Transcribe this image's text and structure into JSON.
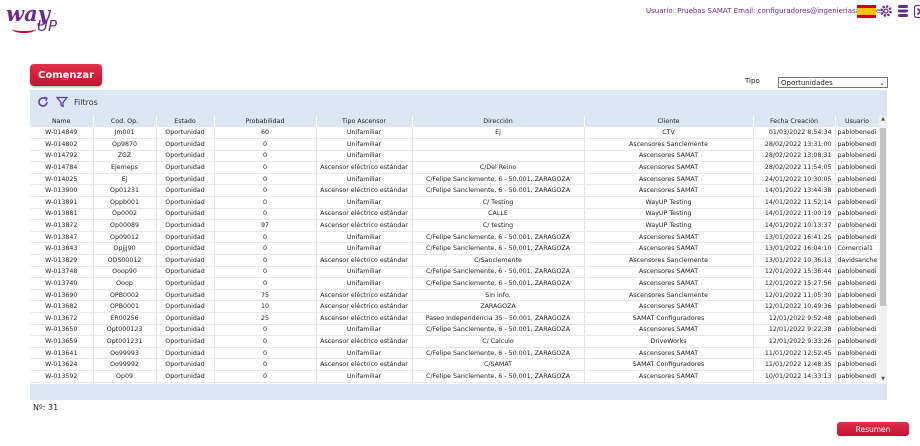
{
  "logo": {
    "way": "way",
    "up": "UP"
  },
  "user_info": "Usuario: Pruebas SAMAT Email: configuradores@ingenieriasamat.es",
  "top_icons": [
    "spain-flag-icon",
    "settings-icon",
    "database-icon",
    "close-icon"
  ],
  "colors": {
    "brand": "#6b2b8e",
    "accent": "#c41230",
    "panel": "#dde6f4"
  },
  "start_button": "Comenzar",
  "tipo": {
    "label": "Tipo",
    "selected": "Oportunidades"
  },
  "filters": {
    "label": "Filtros",
    "icons": [
      "refresh-icon",
      "filter-icon"
    ]
  },
  "table": {
    "columns": [
      "Name",
      "Cod. Op.",
      "Estado",
      "Probabilidad",
      "Tipo Ascensor",
      "Dirección",
      "Cliente",
      "Fecha Creación",
      "Usuario"
    ],
    "rows": [
      [
        "W-014849",
        "Jm001",
        "Oportunidad",
        "60",
        "Unifamiliar",
        "Ej",
        "CTV",
        "01/03/2022 8:54:34",
        "pablobenedi"
      ],
      [
        "W-014802",
        "Op9870",
        "Oportunidad",
        "0",
        "Unifamiliar",
        "",
        "Ascensores Sanclemente",
        "28/02/2022 13:31:00",
        "pablobenedi"
      ],
      [
        "W-014792",
        "ZGZ",
        "Oportunidad",
        "0",
        "Unifamiliar",
        "",
        "Ascensores SAMAT",
        "28/02/2022 13:08:31",
        "pablobenedi"
      ],
      [
        "W-014784",
        "Ejemeps",
        "Oportunidad",
        "0",
        "Ascensor eléctrico estándar",
        "C/Del Reino",
        "Ascensores SAMAT",
        "28/02/2022 11:54:05",
        "pablobenedi"
      ],
      [
        "W-014025",
        "Ej",
        "Oportunidad",
        "0",
        "Unifamiliar",
        "C/Felipe Sanclemente, 6 - 50.001, ZARAGOZA",
        "Ascensores SAMAT",
        "24/01/2022 10:30:05",
        "pablobenedi"
      ],
      [
        "W-013900",
        "Op01231",
        "Oportunidad",
        "0",
        "Ascensor eléctrico estándar",
        "C/Felipe Sanclemente, 6 - 50.001, ZARAGOZA",
        "Ascensores SAMAT",
        "14/01/2022 13:44:38",
        "pablobenedi"
      ],
      [
        "W-013891",
        "Oppb001",
        "Oportunidad",
        "0",
        "Unifamiliar",
        "C/ Testing",
        "WayUP Testing",
        "14/01/2022 11:52:14",
        "pablobenedi"
      ],
      [
        "W-013881",
        "Op0002",
        "Oportunidad",
        "0",
        "Ascensor eléctrico estándar",
        "CALLE",
        "WayUP Testing",
        "14/01/2022 11:00:19",
        "pablobenedi"
      ],
      [
        "W-013872",
        "Op00089",
        "Oportunidad",
        "97",
        "Ascensor eléctrico estándar",
        "C/ testing",
        "WayUP Testing",
        "14/01/2022 10:13:37",
        "pablobenedi"
      ],
      [
        "W-013847",
        "Op09012",
        "Oportunidad",
        "0",
        "Unifamiliar",
        "C/Felipe Sanclemente, 6 - 50.001, ZARAGOZA",
        "Ascensores SAMAT",
        "13/01/2022 16:41:25",
        "pablobenedi"
      ],
      [
        "W-013843",
        "Opjjj90",
        "Oportunidad",
        "0",
        "Unifamiliar",
        "C/Felipe Sanclemente, 6 - 50.001, ZARAGOZA",
        "Ascensores SAMAT",
        "13/01/2022 16:04:10",
        "Comercial1"
      ],
      [
        "W-013829",
        "ODS00012",
        "Oportunidad",
        "0",
        "Ascensor eléctrico estándar",
        "C/Sanclemente",
        "Ascensores Sanclemente",
        "13/01/2022 10:36:13",
        "davidsanche"
      ],
      [
        "W-013748",
        "Ooop90",
        "Oportunidad",
        "0",
        "Unifamiliar",
        "C/Felipe Sanclemente, 6 - 50.001, ZARAGOZA",
        "Ascensores SAMAT",
        "12/01/2022 15:36:44",
        "pablobenedi"
      ],
      [
        "W-013740",
        "Ooop",
        "Oportunidad",
        "0",
        "Unifamiliar",
        "C/Felipe Sanclemente, 6 - 50.001, ZARAGOZA",
        "Ascensores SAMAT",
        "12/01/2022 15:27:56",
        "pablobenedi"
      ],
      [
        "W-013690",
        "OPB0002",
        "Oportunidad",
        "75",
        "Ascensor eléctrico estándar",
        "Sin info.",
        "Ascensores Sanclemente",
        "12/01/2022 11:05:30",
        "pablobenedi"
      ],
      [
        "W-013682",
        "OPB0001",
        "Oportunidad",
        "10",
        "Ascensor eléctrico estándar",
        "ZARAGOZA",
        "Ascensores SAMAT",
        "12/01/2022 10:49:36",
        "pablobenedi"
      ],
      [
        "W-013672",
        "ER00256",
        "Oportunidad",
        "25",
        "Ascensor eléctrico estándar",
        "Paseo Independencia 35 - 50.001, ZARAGOZA",
        "SAMAT Configuradores",
        "12/01/2022 9:52:48",
        "pablobenedi"
      ],
      [
        "W-013650",
        "Opt000123",
        "Oportunidad",
        "0",
        "Unifamiliar",
        "C/Felipe Sanclemente, 6 - 50.001, ZARAGOZA",
        "Ascensores SAMAT",
        "12/01/2022 9:22:38",
        "pablobenedi"
      ],
      [
        "W-013659",
        "Opt001231",
        "Oportunidad",
        "0",
        "Ascensor eléctrico estándar",
        "C/ Calculo",
        "DriveWorks",
        "12/01/2022 9:33:26",
        "pablobenedi"
      ],
      [
        "W-013641",
        "Oo99993",
        "Oportunidad",
        "0",
        "Unifamiliar",
        "C/Felipe Sanclemente, 6 - 50.001, ZARAGOZA",
        "Ascensores SAMAT",
        "11/01/2022 12:52:45",
        "pablobenedi"
      ],
      [
        "W-013624",
        "Oo99992",
        "Oportunidad",
        "0",
        "Ascensor eléctrico estándar",
        "C/SAMAT",
        "SAMAT Configuradores",
        "11/01/2022 12:48:35",
        "pablobenedi"
      ],
      [
        "W-013592",
        "Op09",
        "Oportunidad",
        "0",
        "Unifamiliar",
        "C/Felipe Sanclemente, 6 - 50.001, ZARAGOZA",
        "Ascensores SAMAT",
        "10/01/2022 14:33:13",
        "pablobenedi"
      ]
    ]
  },
  "count_label": "Nº: 31",
  "resumen_button": "Resumen"
}
